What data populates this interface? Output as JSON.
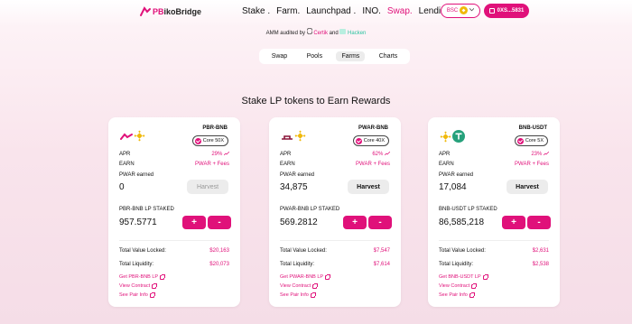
{
  "header": {
    "logo_pb": "PB",
    "logo_rest": "ikoBridge",
    "nav": [
      {
        "label": "Stake .",
        "active": false
      },
      {
        "label": "Farm.",
        "active": false
      },
      {
        "label": "Launchpad .",
        "active": false
      },
      {
        "label": "INO.",
        "active": false
      },
      {
        "label": "Swap.",
        "active": true
      },
      {
        "label": "Lending.",
        "active": false
      }
    ],
    "network": "BSC",
    "wallet": "0XS...5831"
  },
  "audit": {
    "prefix": "AMM audited by",
    "certik": "Certik",
    "and": "and",
    "hacken": "Hacken"
  },
  "tabs": [
    {
      "label": "Swap",
      "active": false
    },
    {
      "label": "Pools",
      "active": false
    },
    {
      "label": "Farms",
      "active": true
    },
    {
      "label": "Charts",
      "active": false
    }
  ],
  "headline": "Stake LP tokens to Earn Rewards",
  "labels": {
    "apr": "APR",
    "earn": "EARN",
    "harvest": "Harvest",
    "plus": "+",
    "minus": "-",
    "tvl": "Total Value Locked:",
    "liquidity": "Total Liquidity:",
    "view_contract": "View Contract",
    "see_pair": "See Pair Info"
  },
  "cards": [
    {
      "pair": "PBR-BNB",
      "multiplier": "Core 50X",
      "apr": "29%",
      "earn": "PWAR + Fees",
      "earned_label": "PWAR earned",
      "earned": "0",
      "harvest_enabled": false,
      "staked_label": "PBR-BNB LP STAKED",
      "staked": "957.5771",
      "tvl": "$20,163",
      "liquidity": "$20,073",
      "get_lp": "Get PBR-BNB LP",
      "token_a": "pbr",
      "token_b": "bnb"
    },
    {
      "pair": "PWAR-BNB",
      "multiplier": "Core 40X",
      "apr": "62%",
      "earn": "PWAR + Fees",
      "earned_label": "PWAR earned",
      "earned": "34,875",
      "harvest_enabled": true,
      "staked_label": "PWAR-BNB LP STAKED",
      "staked": "569.2812",
      "tvl": "$7,547",
      "liquidity": "$7,614",
      "get_lp": "Get PWAR-BNB LP",
      "token_a": "pwar",
      "token_b": "bnb"
    },
    {
      "pair": "BNB-USDT",
      "multiplier": "Core 5X",
      "apr": "23%",
      "earn": "PWAR + Fees",
      "earned_label": "PWAR earned",
      "earned": "17,084",
      "harvest_enabled": true,
      "staked_label": "BNB-USDT LP STAKED",
      "staked": "86,585,218",
      "tvl": "$2,631",
      "liquidity": "$2,538",
      "get_lp": "Get BNB-USDT LP",
      "token_a": "bnb",
      "token_b": "usdt"
    }
  ],
  "colors": {
    "accent": "#e0117a",
    "bnb": "#f0b90b",
    "usdt": "#26a17b",
    "hacken": "#2cc3a0"
  }
}
